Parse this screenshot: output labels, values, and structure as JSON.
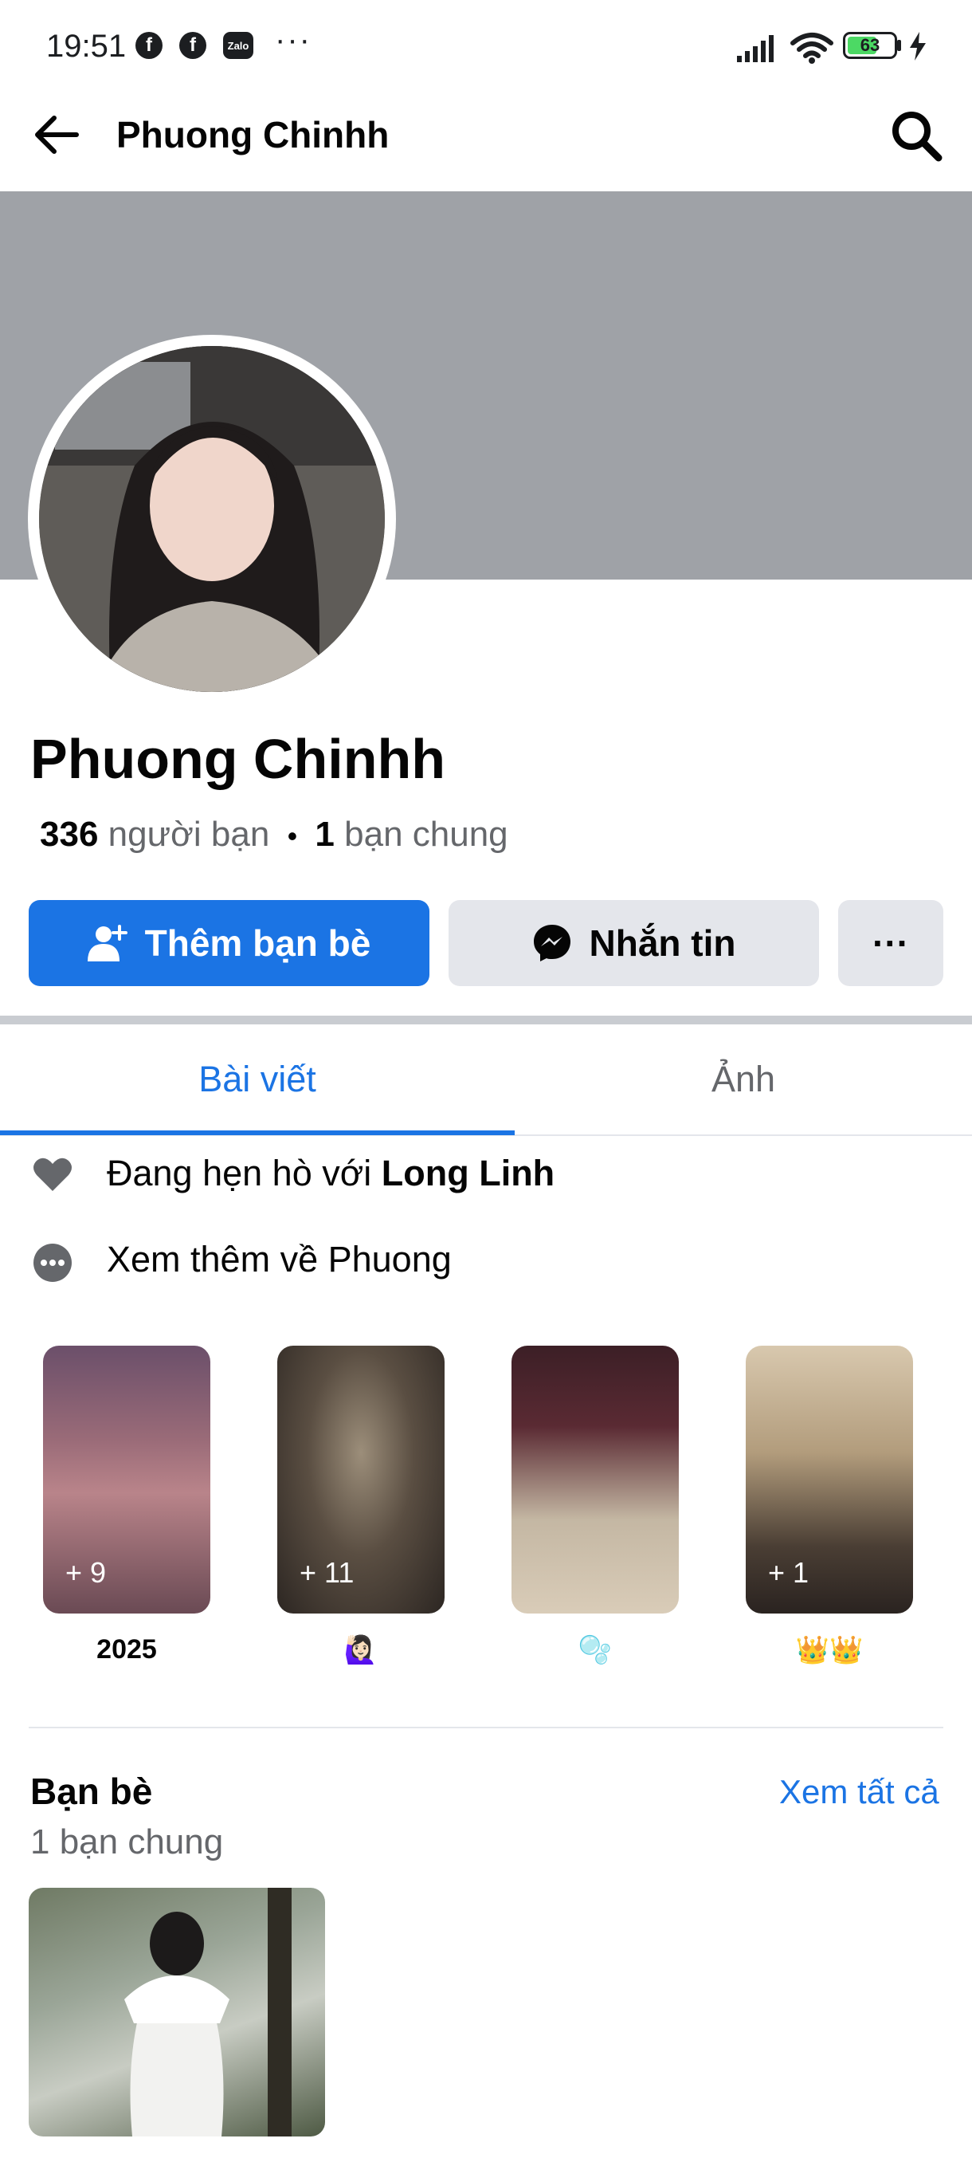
{
  "status_bar": {
    "time": "19:51",
    "notification_icons": [
      "facebook-icon",
      "facebook-icon",
      "zalo-icon"
    ],
    "zalo_text": "Zalo",
    "more": "···",
    "battery": "63",
    "signal_icon": "cellular-signal-icon",
    "wifi_icon": "wifi-icon",
    "charging_icon": "bolt-icon"
  },
  "app_bar": {
    "title": "Phuong Chinhh",
    "back_icon": "arrow-left-icon",
    "search_icon": "search-icon"
  },
  "profile": {
    "name": "Phuong Chinhh",
    "friend_count": "336",
    "friend_label": "người bạn",
    "separator": "•",
    "mutual_count": "1",
    "mutual_label": "bạn chung"
  },
  "actions": {
    "add_friend_label": "Thêm bạn bè",
    "message_label": "Nhắn tin",
    "more_label": "···"
  },
  "tabs": [
    {
      "label": "Bài viết",
      "active": true
    },
    {
      "label": "Ảnh",
      "active": false
    }
  ],
  "intro": {
    "relationship_prefix": "Đang hẹn hò với",
    "relationship_name": "Long Linh",
    "see_more_label": "Xem thêm về Phuong"
  },
  "highlights": [
    {
      "label": "2025",
      "count": "+ 9"
    },
    {
      "label": "🙋🏻‍♀️",
      "count": "+ 11"
    },
    {
      "label": "🫧",
      "count": ""
    },
    {
      "label": "👑👑",
      "count": "+ 1"
    }
  ],
  "friends_section": {
    "title": "Bạn bè",
    "see_all": "Xem tất cả",
    "mutual": "1 bạn chung"
  },
  "colors": {
    "accent": "#1b74e4",
    "cover": "#9fa2a7",
    "secondary_button": "#e4e6eb",
    "muted_text": "#65676b"
  }
}
